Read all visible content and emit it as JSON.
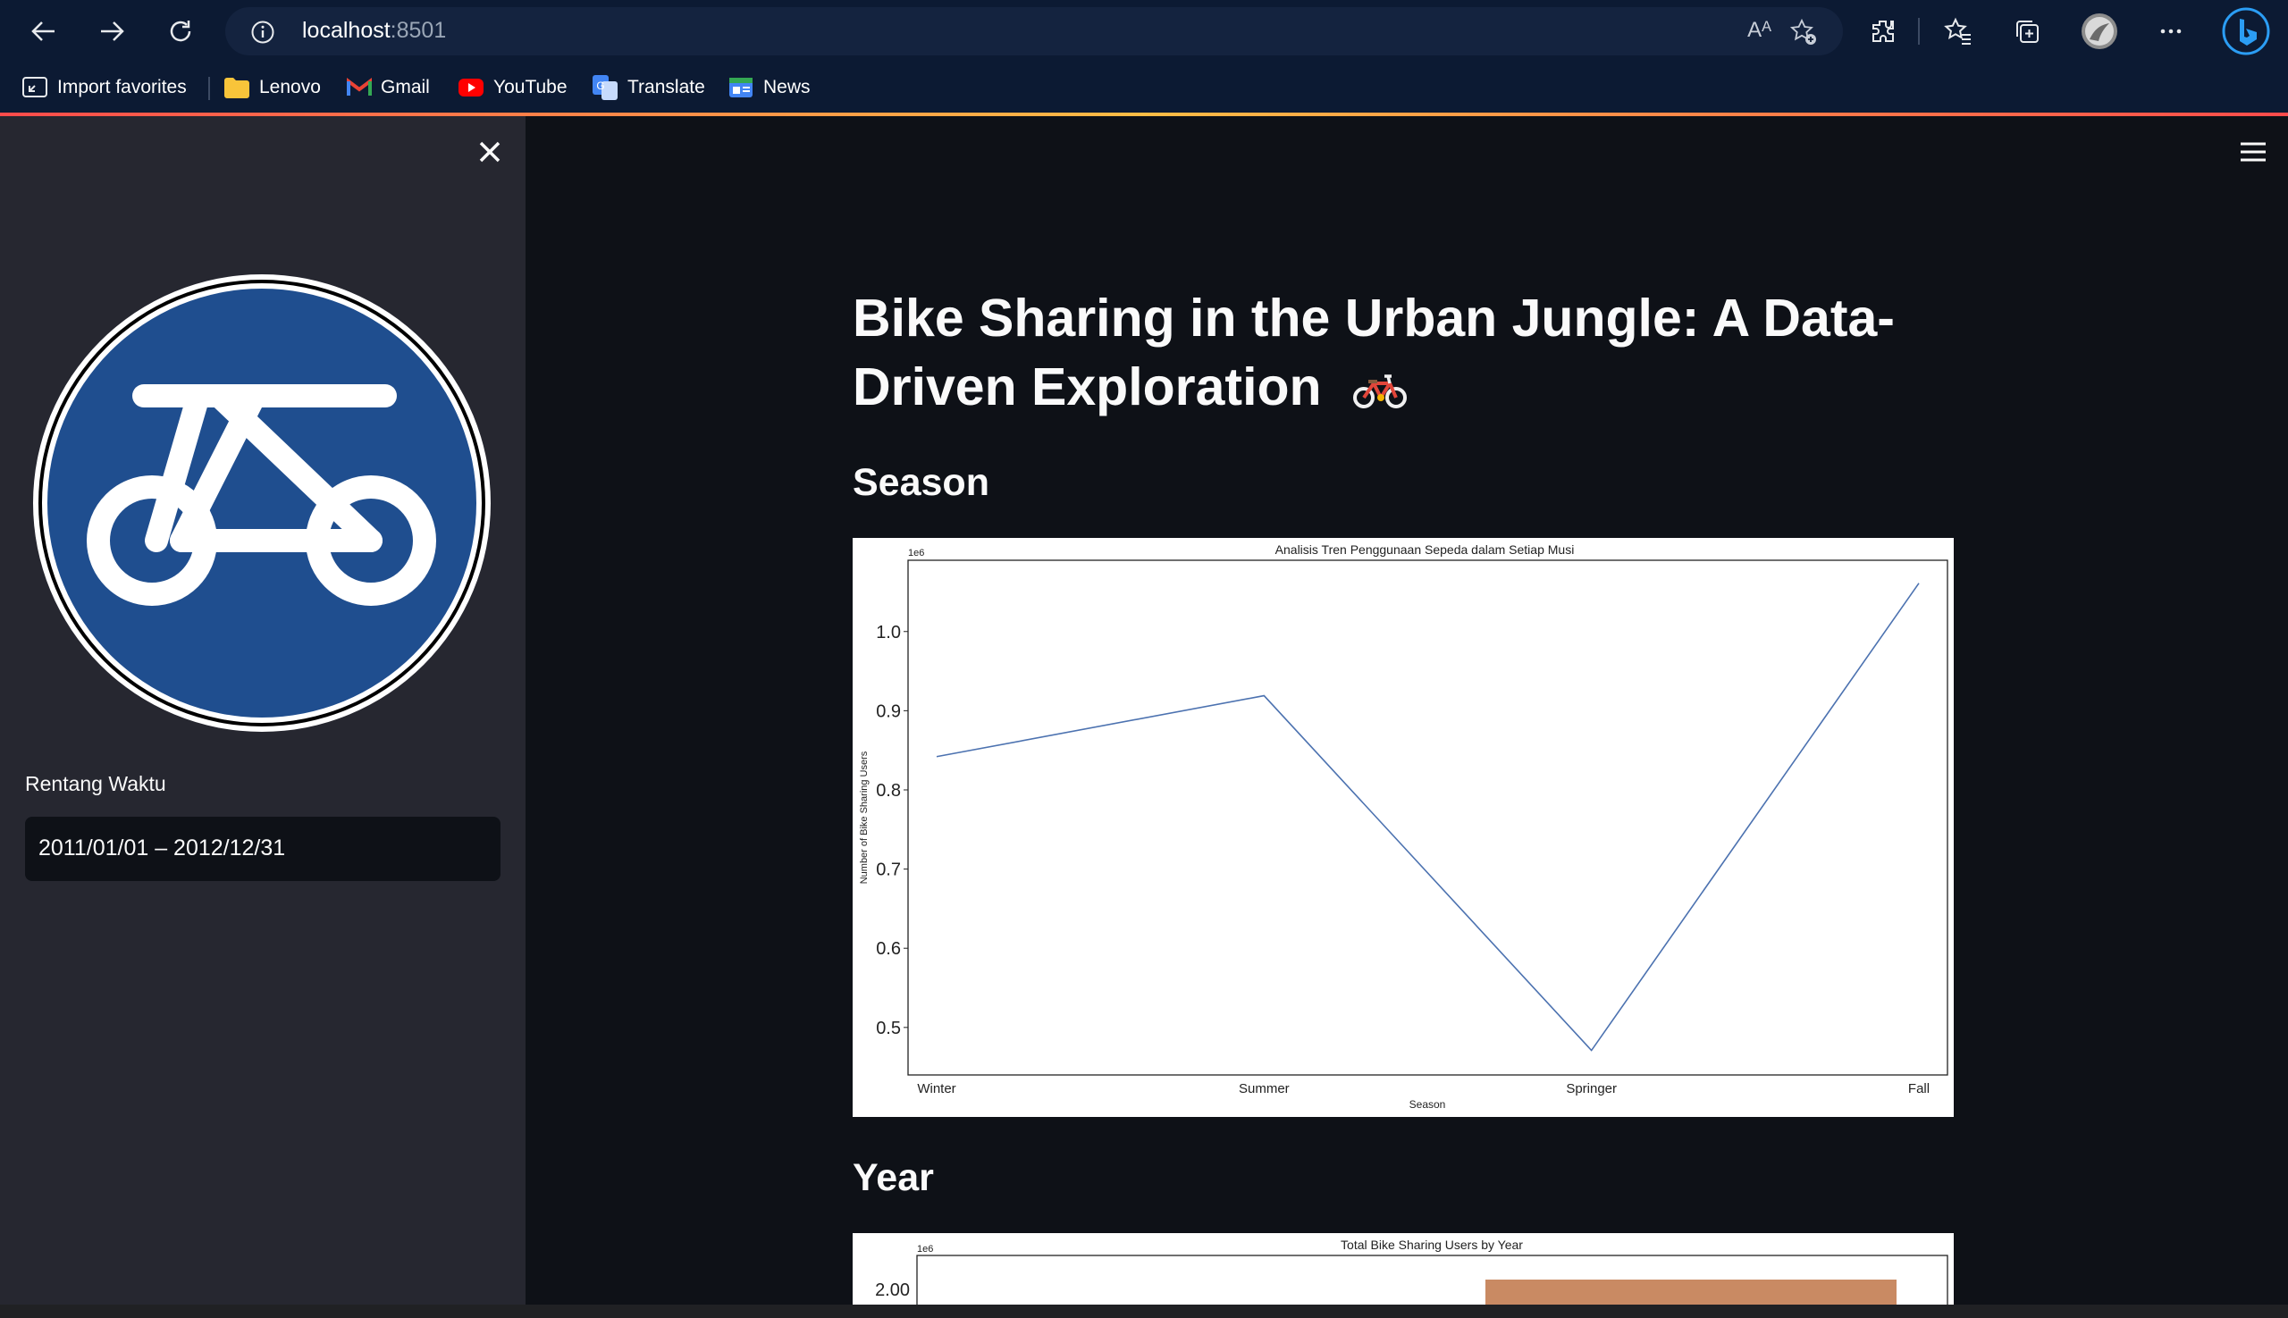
{
  "browser": {
    "url_host": "localhost",
    "url_port": ":8501",
    "read_aloud": "Aᴬ",
    "icons": [
      "back-icon",
      "forward-icon",
      "refresh-icon",
      "info-icon",
      "favorite-add-icon",
      "extensions-icon",
      "favorites-icon",
      "collections-icon",
      "profile-avatar",
      "more-icon",
      "bing-icon"
    ],
    "bookmarks": [
      {
        "label": "Import favorites",
        "icon": "import-icon"
      },
      {
        "label": "Lenovo",
        "icon": "folder-icon"
      },
      {
        "label": "Gmail",
        "icon": "gmail-icon"
      },
      {
        "label": "YouTube",
        "icon": "youtube-icon"
      },
      {
        "label": "Translate",
        "icon": "translate-icon"
      },
      {
        "label": "News",
        "icon": "news-icon"
      }
    ]
  },
  "sidebar": {
    "date_range_label": "Rentang Waktu",
    "date_range_value": "2011/01/01 – 2012/12/31"
  },
  "main": {
    "title_line1": "Bike Sharing in the Urban Jungle: A Data-",
    "title_line2": "Driven Exploration",
    "title_emoji_icon": "bicycle-icon",
    "season_heading": "Season",
    "year_heading": "Year"
  },
  "colors": {
    "accent": "#ff4b4b",
    "line": "#4c72b0",
    "bar": "#dd8452",
    "sidebar": "#262730",
    "background": "#0e1117"
  },
  "chart_data": [
    {
      "type": "line",
      "title": "Analisis Tren Penggunaan Sepeda dalam Setiap Musi",
      "xlabel": "Season",
      "ylabel": "Number of Bike Sharing Users",
      "scale_note": "1e6",
      "categories": [
        "Winter",
        "Summer",
        "Springer",
        "Fall"
      ],
      "values": [
        0.842,
        0.919,
        0.471,
        1.061
      ],
      "ylim": [
        0.44,
        1.09
      ],
      "yticks": [
        "0.5",
        "0.6",
        "0.7",
        "0.8",
        "0.9",
        "1.0"
      ],
      "grid": false
    },
    {
      "type": "bar",
      "title": "Total Bike Sharing Users by Year",
      "scale_note": "1e6",
      "yticks_visible": [
        "2.00"
      ],
      "partially_visible": true
    }
  ]
}
